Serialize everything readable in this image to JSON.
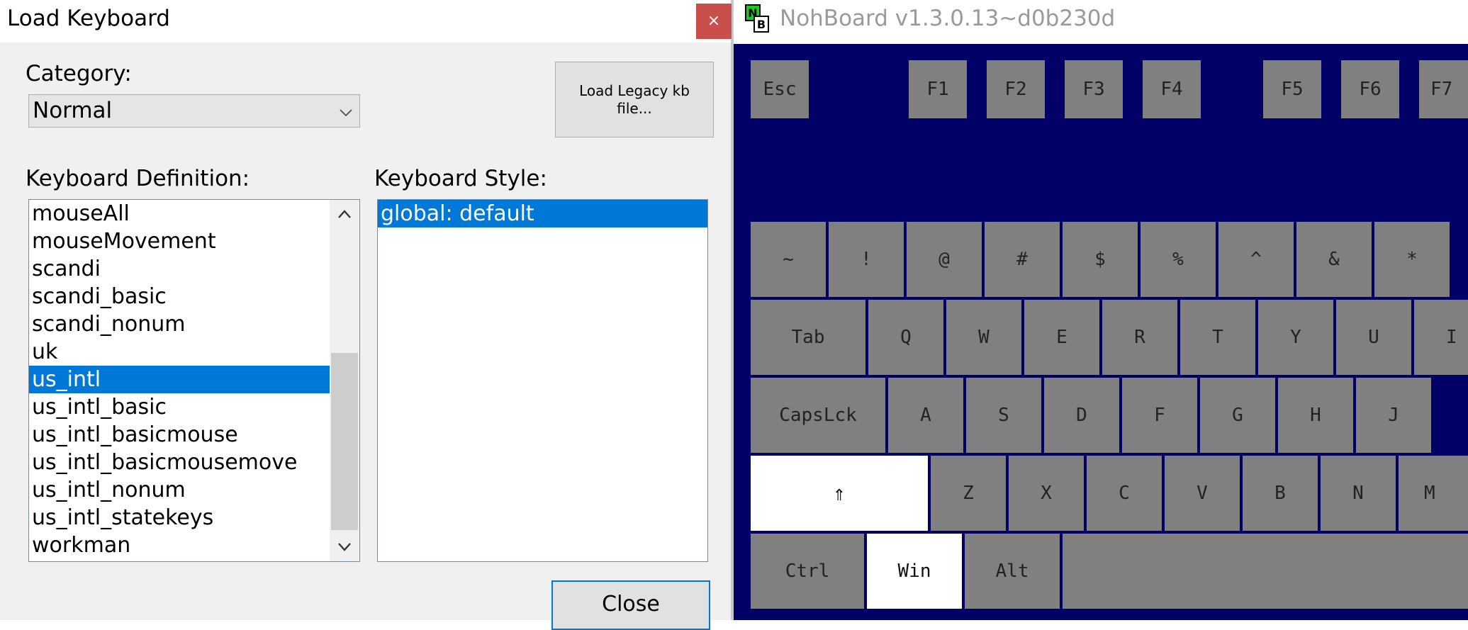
{
  "dialog": {
    "title": "Load Keyboard",
    "close_glyph": "×",
    "category_label": "Category:",
    "category_value": "Normal",
    "legacy_button": "Load Legacy kb file...",
    "definition_label": "Keyboard Definition:",
    "definitions": [
      "mouseAll",
      "mouseMovement",
      "scandi",
      "scandi_basic",
      "scandi_nonum",
      "uk",
      "us_intl",
      "us_intl_basic",
      "us_intl_basicmouse",
      "us_intl_basicmousemove",
      "us_intl_nonum",
      "us_intl_statekeys",
      "workman"
    ],
    "selected_definition": "us_intl",
    "style_label": "Keyboard Style:",
    "styles": [
      "global: default"
    ],
    "selected_style": "global: default",
    "close_button": "Close"
  },
  "nohboard": {
    "title": "NohBoard v1.3.0.13~d0b230d",
    "colors": {
      "background": "#000066",
      "key": "#808080",
      "key_pressed": "#ffffff"
    },
    "keys": {
      "esc": "Esc",
      "f1": "F1",
      "f2": "F2",
      "f3": "F3",
      "f4": "F4",
      "f5": "F5",
      "f6": "F6",
      "f7": "F7",
      "tilde": "~",
      "excl": "!",
      "at": "@",
      "hash": "#",
      "dollar": "$",
      "percent": "%",
      "caret": "^",
      "amp": "&",
      "star": "*",
      "tab": "Tab",
      "q": "Q",
      "w": "W",
      "e": "E",
      "r": "R",
      "t": "T",
      "y": "Y",
      "u": "U",
      "i": "I",
      "caps": "CapsLck",
      "a": "A",
      "s": "S",
      "d": "D",
      "f": "F",
      "g": "G",
      "h": "H",
      "j": "J",
      "shift": "⇑",
      "z": "Z",
      "x": "X",
      "c": "C",
      "v": "V",
      "b": "B",
      "n": "N",
      "m": "M",
      "ctrl": "Ctrl",
      "win": "Win",
      "alt": "Alt",
      "space": ""
    },
    "pressed_keys": [
      "shift",
      "win"
    ]
  }
}
